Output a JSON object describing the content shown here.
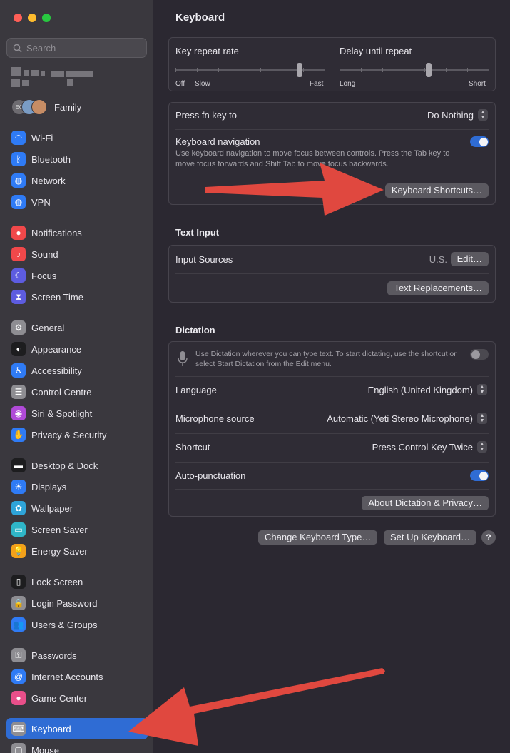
{
  "sidebar": {
    "search_placeholder": "Search",
    "family_label": "Family",
    "family_avatar_initials": "EC",
    "groups": [
      [
        {
          "label": "Wi-Fi",
          "icon": "wifi-icon",
          "color": "#2f7bf5",
          "glyph": "◠"
        },
        {
          "label": "Bluetooth",
          "icon": "bluetooth-icon",
          "color": "#2f7bf5",
          "glyph": "ᛒ"
        },
        {
          "label": "Network",
          "icon": "globe-icon",
          "color": "#2f7bf5",
          "glyph": "◍"
        },
        {
          "label": "VPN",
          "icon": "vpn-globe-icon",
          "color": "#2f7bf5",
          "glyph": "◍"
        }
      ],
      [
        {
          "label": "Notifications",
          "icon": "bell-icon",
          "color": "#f0484a",
          "glyph": "●"
        },
        {
          "label": "Sound",
          "icon": "speaker-icon",
          "color": "#f0484a",
          "glyph": "♪"
        },
        {
          "label": "Focus",
          "icon": "moon-icon",
          "color": "#5d5ce0",
          "glyph": "☾"
        },
        {
          "label": "Screen Time",
          "icon": "hourglass-icon",
          "color": "#5d5ce0",
          "glyph": "⧗"
        }
      ],
      [
        {
          "label": "General",
          "icon": "gear-icon",
          "color": "#8e8d92",
          "glyph": "⚙"
        },
        {
          "label": "Appearance",
          "icon": "appearance-icon",
          "color": "#1d1d1f",
          "glyph": "◐"
        },
        {
          "label": "Accessibility",
          "icon": "accessibility-icon",
          "color": "#2f7bf5",
          "glyph": "♿"
        },
        {
          "label": "Control Centre",
          "icon": "control-centre-icon",
          "color": "#8e8d92",
          "glyph": "☰"
        },
        {
          "label": "Siri & Spotlight",
          "icon": "siri-icon",
          "color": "#b04ad8",
          "glyph": "◉"
        },
        {
          "label": "Privacy & Security",
          "icon": "hand-icon",
          "color": "#2f7bf5",
          "glyph": "✋"
        }
      ],
      [
        {
          "label": "Desktop & Dock",
          "icon": "dock-icon",
          "color": "#1d1d1f",
          "glyph": "▬"
        },
        {
          "label": "Displays",
          "icon": "sun-icon",
          "color": "#2f7bf5",
          "glyph": "☀"
        },
        {
          "label": "Wallpaper",
          "icon": "flower-icon",
          "color": "#2fa4d8",
          "glyph": "✿"
        },
        {
          "label": "Screen Saver",
          "icon": "screen-saver-icon",
          "color": "#2fb6c8",
          "glyph": "▭"
        },
        {
          "label": "Energy Saver",
          "icon": "bulb-icon",
          "color": "#f2a11a",
          "glyph": "💡"
        }
      ],
      [
        {
          "label": "Lock Screen",
          "icon": "lock-screen-icon",
          "color": "#1d1d1f",
          "glyph": "▯"
        },
        {
          "label": "Login Password",
          "icon": "lock-icon",
          "color": "#8e8d92",
          "glyph": "🔒"
        },
        {
          "label": "Users & Groups",
          "icon": "users-icon",
          "color": "#2f7bf5",
          "glyph": "👥"
        }
      ],
      [
        {
          "label": "Passwords",
          "icon": "key-icon",
          "color": "#8e8d92",
          "glyph": "⚿"
        },
        {
          "label": "Internet Accounts",
          "icon": "at-icon",
          "color": "#2f7bf5",
          "glyph": "@"
        },
        {
          "label": "Game Center",
          "icon": "game-center-icon",
          "color": "#e94f8a",
          "glyph": "●"
        }
      ],
      [
        {
          "label": "Keyboard",
          "icon": "keyboard-icon",
          "color": "#8e8d92",
          "glyph": "⌨",
          "active": true
        },
        {
          "label": "Mouse",
          "icon": "mouse-icon",
          "color": "#8e8d92",
          "glyph": "▢"
        }
      ]
    ]
  },
  "main": {
    "title": "Keyboard",
    "key_repeat_label": "Key repeat rate",
    "key_repeat_off": "Off",
    "key_repeat_slow": "Slow",
    "key_repeat_fast": "Fast",
    "key_repeat_level": 0.84,
    "delay_label": "Delay until repeat",
    "delay_long": "Long",
    "delay_short": "Short",
    "delay_level": 0.6,
    "fn_label": "Press fn key to",
    "fn_value": "Do Nothing",
    "kbnav_label": "Keyboard navigation",
    "kbnav_desc": "Use keyboard navigation to move focus between controls. Press the Tab key to move focus forwards and Shift Tab to move focus backwards.",
    "kbnav_on": true,
    "shortcuts_button": "Keyboard Shortcuts…",
    "text_input_heading": "Text Input",
    "input_sources_label": "Input Sources",
    "input_sources_value": "U.S.",
    "edit_button": "Edit…",
    "text_replacements_button": "Text Replacements…",
    "dictation_heading": "Dictation",
    "dictation_desc": "Use Dictation wherever you can type text. To start dictating, use the shortcut or select Start Dictation from the Edit menu.",
    "dictation_on": false,
    "language_label": "Language",
    "language_value": "English (United Kingdom)",
    "mic_label": "Microphone source",
    "mic_value": "Automatic (Yeti Stereo Microphone)",
    "shortcut_label": "Shortcut",
    "shortcut_value": "Press Control Key Twice",
    "autopunct_label": "Auto-punctuation",
    "autopunct_on": true,
    "about_button": "About Dictation & Privacy…",
    "change_type_button": "Change Keyboard Type…",
    "setup_button": "Set Up Keyboard…",
    "help_glyph": "?"
  },
  "colors": {
    "accent": "#2f6cd4",
    "annotation_arrow": "#e0483f"
  }
}
